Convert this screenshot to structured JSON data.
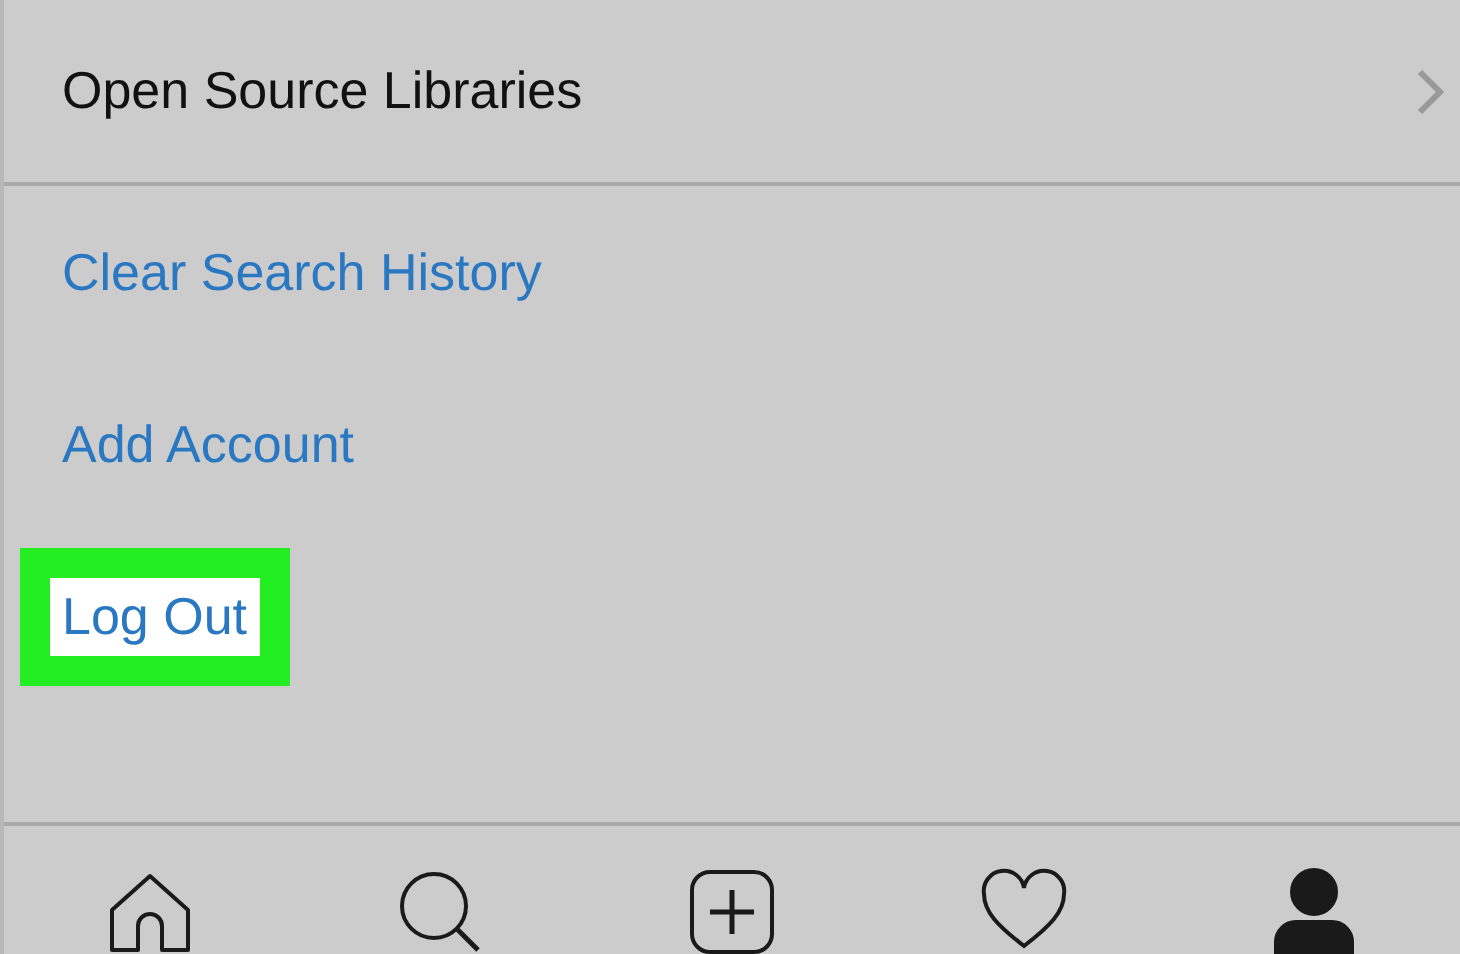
{
  "settings_row": {
    "label": "Open Source Libraries",
    "kind": "nav"
  },
  "actions": [
    {
      "label": "Clear Search History",
      "highlighted": false
    },
    {
      "label": "Add Account",
      "highlighted": false
    },
    {
      "label": "Log Out",
      "highlighted": true
    }
  ],
  "tab_bar": [
    {
      "kind": "home",
      "selected": false
    },
    {
      "kind": "search",
      "selected": false
    },
    {
      "kind": "add",
      "selected": false
    },
    {
      "kind": "activity",
      "selected": false
    },
    {
      "kind": "profile",
      "selected": true
    }
  ]
}
